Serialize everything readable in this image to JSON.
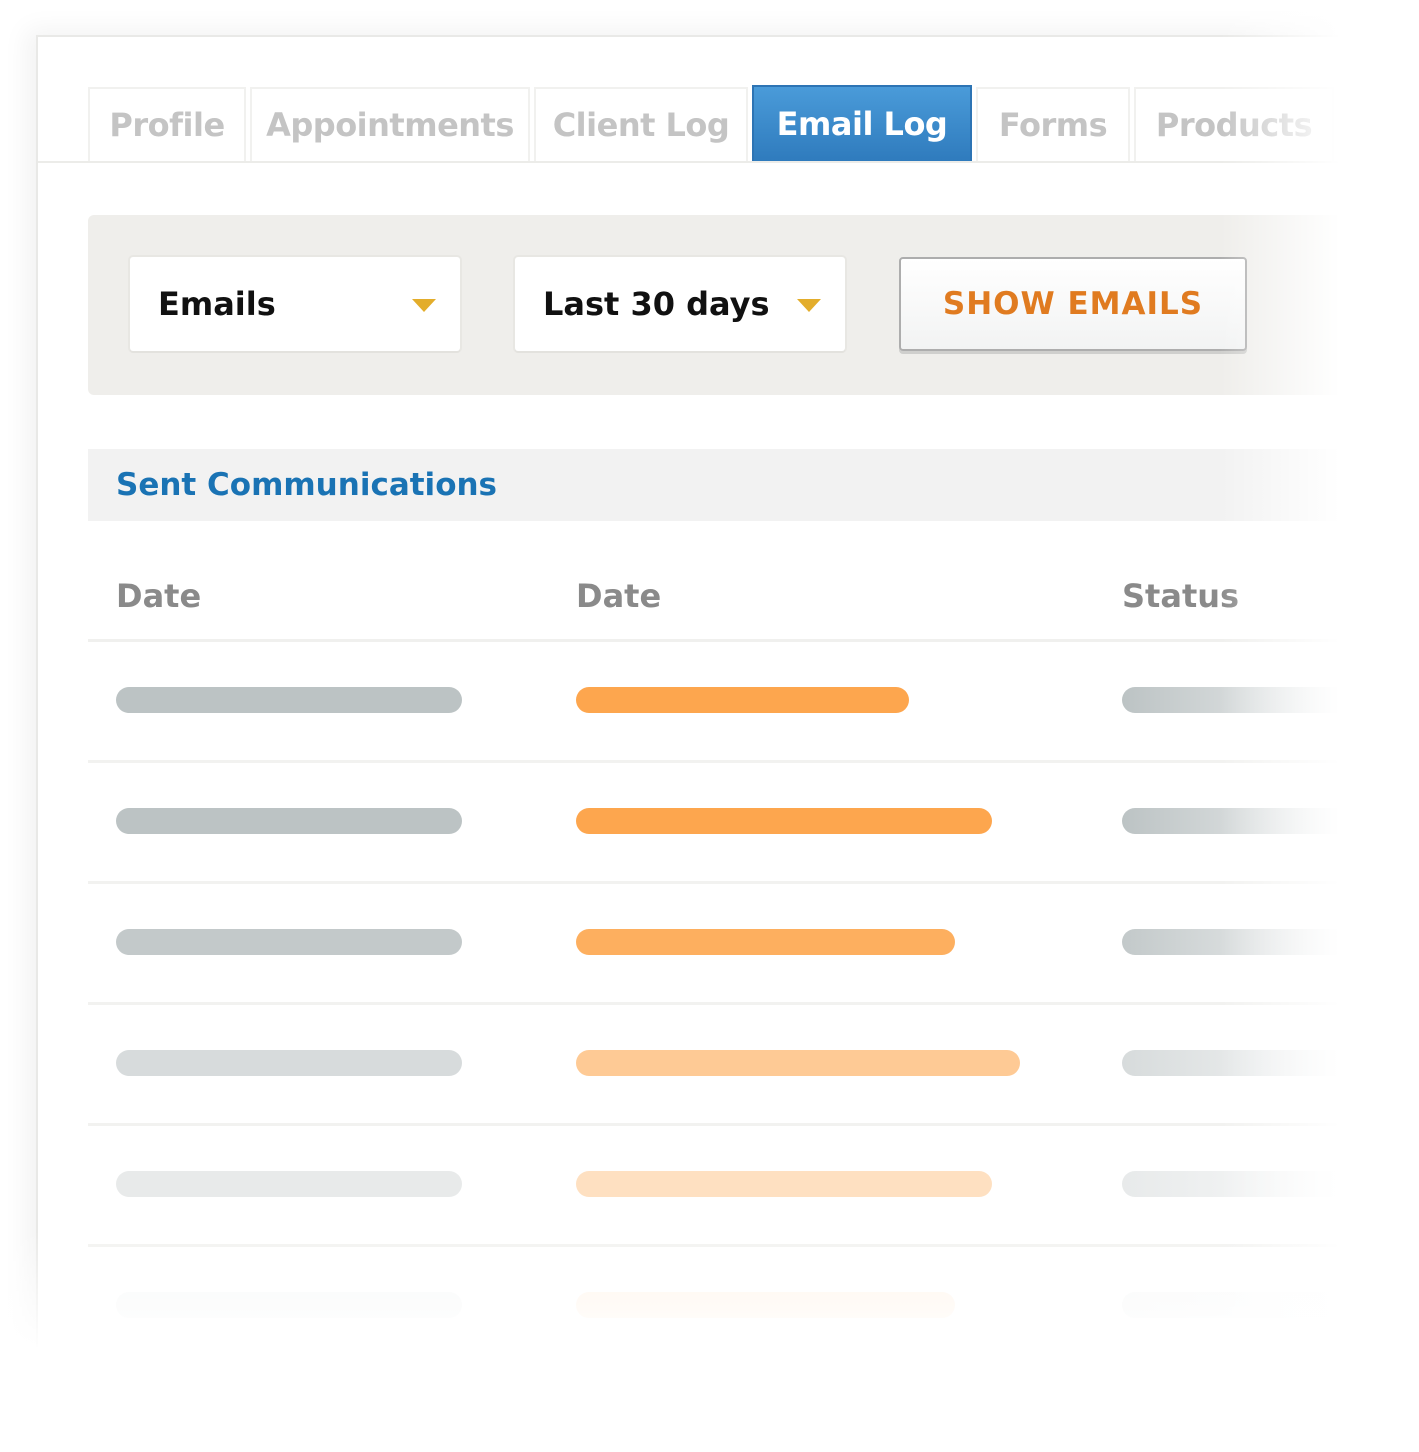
{
  "tabs": [
    {
      "label": "Profile",
      "active": false
    },
    {
      "label": "Appointments",
      "active": false
    },
    {
      "label": "Client Log",
      "active": false
    },
    {
      "label": "Email Log",
      "active": true
    },
    {
      "label": "Forms",
      "active": false
    },
    {
      "label": "Products",
      "active": false
    }
  ],
  "filters": {
    "type_select": {
      "value": "Emails"
    },
    "range_select": {
      "value": "Last 30 days"
    },
    "show_button": "SHOW EMAILS"
  },
  "section": {
    "title": "Sent Communications"
  },
  "table": {
    "columns": [
      "Date",
      "Date",
      "Status"
    ],
    "rows": [
      {
        "opacity": 1.0,
        "col1_fill": 1.0,
        "col2_fill": 0.72
      },
      {
        "opacity": 1.0,
        "col1_fill": 1.0,
        "col2_fill": 0.9
      },
      {
        "opacity": 0.9,
        "col1_fill": 1.0,
        "col2_fill": 0.82
      },
      {
        "opacity": 0.6,
        "col1_fill": 1.0,
        "col2_fill": 0.96
      },
      {
        "opacity": 0.35,
        "col1_fill": 1.0,
        "col2_fill": 0.9
      },
      {
        "opacity": 0.12,
        "col1_fill": 1.0,
        "col2_fill": 0.82
      }
    ]
  },
  "colors": {
    "accent_blue": "#2f7bbd",
    "section_title": "#1a73b4",
    "button_text": "#e07b20",
    "caret": "#e3ad2b",
    "placeholder_gray": "#bcc3c4",
    "placeholder_orange": "#fda64e"
  }
}
